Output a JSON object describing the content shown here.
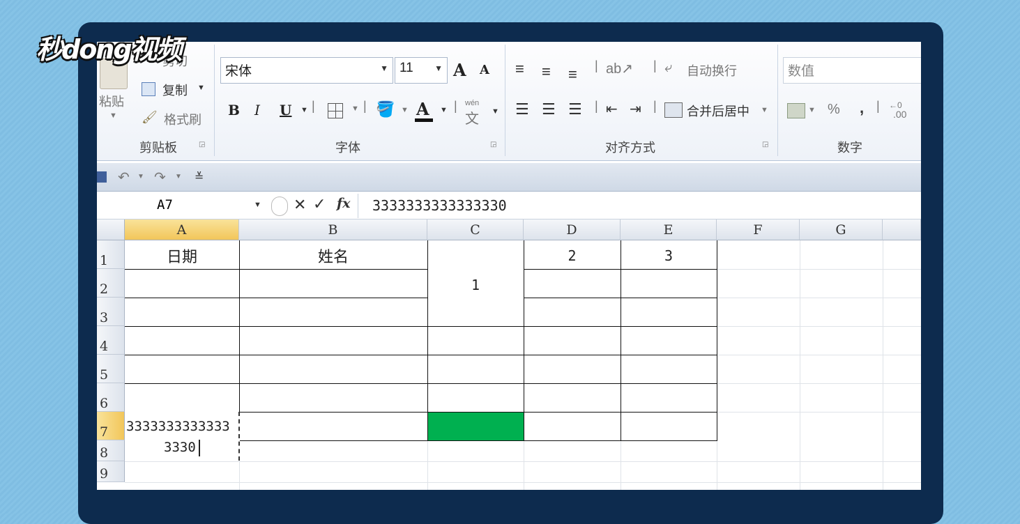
{
  "watermark": "秒dong视频",
  "ribbon": {
    "clipboard": {
      "paste_label": "粘贴",
      "cut_label": "剪切",
      "copy_label": "复制",
      "format_painter_label": "格式刷",
      "group_label": "剪贴板"
    },
    "font": {
      "font_name": "宋体",
      "font_size": "11",
      "bold": "B",
      "italic": "I",
      "underline": "U",
      "grow_font": "A",
      "shrink_font": "A",
      "font_color": "A",
      "phonetic": "wén",
      "group_label": "字体"
    },
    "alignment": {
      "wrap_text_label": "自动换行",
      "merge_center_label": "合并后居中",
      "group_label": "对齐方式"
    },
    "number": {
      "format_value": "数值",
      "percent": "%",
      "comma": ",",
      "increase_decimal": ".00",
      "group_label": "数字"
    }
  },
  "formula_bar": {
    "name_box": "A7",
    "formula": "3333333333333330"
  },
  "sheet": {
    "columns": [
      "A",
      "B",
      "C",
      "D",
      "E",
      "F",
      "G",
      ""
    ],
    "rows": [
      "1",
      "2",
      "3",
      "4",
      "5",
      "6",
      "7",
      "8",
      "9"
    ],
    "cells": {
      "A1": "日期",
      "B1": "姓名",
      "C1_merged": "1",
      "D1": "2",
      "E1": "3",
      "A7_line1": "3333333333333",
      "A7_line2": "3330"
    },
    "selected_cell": "A7",
    "fill_color_C7": "#00b050"
  }
}
